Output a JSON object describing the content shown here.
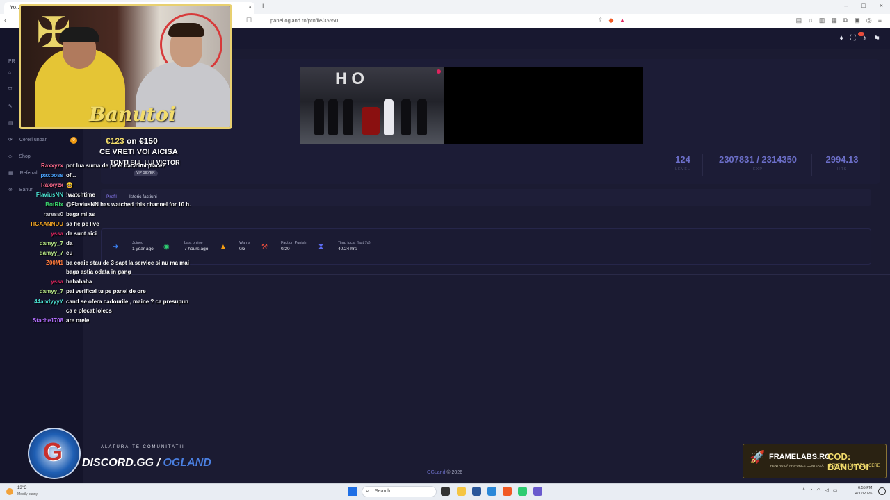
{
  "browser": {
    "tab_title": "Yo...",
    "tab_close": "×",
    "new_tab": "+",
    "url": "panel.ogland.ro/profile/35550",
    "win_min": "–",
    "win_max": "□",
    "win_close": "×"
  },
  "sidebar": {
    "section_label": "PR",
    "items": [
      {
        "label": "Cereri unban",
        "icon": "refresh-icon",
        "badge": "0"
      },
      {
        "label": "Shop",
        "icon": "diamond-icon"
      },
      {
        "label": "Referral",
        "icon": "gift-icon"
      },
      {
        "label": "Banuri",
        "icon": "ban-icon"
      }
    ]
  },
  "profile": {
    "stats": [
      {
        "value": "124",
        "label": "LEVEL"
      },
      {
        "value": "2307831 / 2314350",
        "label": "EXP"
      },
      {
        "value": "2994.13",
        "label": "HRS"
      }
    ],
    "tabs": [
      "Profil",
      "Istoric factiuni"
    ],
    "info": [
      {
        "label": "Joined",
        "value": "1 year ago",
        "icon": "login-icon",
        "color": "#3b82f6"
      },
      {
        "label": "Last online",
        "value": "7 hours ago",
        "icon": "gamepad-icon",
        "color": "#2ecc71"
      },
      {
        "label": "Warns",
        "value": "0/3",
        "icon": "warning-icon",
        "color": "#f39c12"
      },
      {
        "label": "Faction Punish",
        "value": "0/20",
        "icon": "gavel-icon",
        "color": "#e74c3c"
      },
      {
        "label": "Timp jucat (last 7d)",
        "value": "40.24 hrs",
        "icon": "hourglass-icon",
        "color": "#5b6bf0"
      }
    ]
  },
  "footer": {
    "brand": "OGLand",
    "text": "© 2026"
  },
  "stream": {
    "streamer_name": "Banutoi",
    "goal_current": "€123",
    "goal_mid": "on",
    "goal_target": "€150",
    "goal_message": "CE VRETI VOI AICISA",
    "goal_message2": "TONTI EUL LUI VICTOR",
    "vip_badge": "VIP SILVER",
    "chat": [
      {
        "user": "Raxxyzx",
        "color": "#ff6b8b",
        "msg": "pot lua suma de pe el dacă îmi place?"
      },
      {
        "user": "paxboss",
        "color": "#4aa3ff",
        "msg": "of..."
      },
      {
        "user": "Raxxyzx",
        "color": "#ff6b8b",
        "msg": "😄"
      },
      {
        "user": "FlaviusNN",
        "color": "#4adfd0",
        "msg": "!watchtime"
      },
      {
        "user": "BotRix",
        "color": "#3ad36a",
        "msg": "@FlaviusNN has watched this channel for 10 h."
      },
      {
        "user": "raress0",
        "color": "#c8c8d0",
        "msg": "baga mi as"
      },
      {
        "user": "TIGAANNUU",
        "color": "#f5a623",
        "msg": "sa fie pe live"
      },
      {
        "user": "yssa",
        "color": "#e0245e",
        "msg": "da sunt aici"
      },
      {
        "user": "damyy_7",
        "color": "#b8e986",
        "msg": "da"
      },
      {
        "user": "damyy_7",
        "color": "#b8e986",
        "msg": "eu"
      },
      {
        "user": "Z00M1",
        "color": "#ff7a3d",
        "msg": "ba coaie stau de 3 sapt la service si nu ma mai"
      },
      {
        "user": "",
        "color": "#ffffff",
        "msg": "baga astia odata in gang"
      },
      {
        "user": "yssa",
        "color": "#e0245e",
        "msg": "hahahaha"
      },
      {
        "user": "damyy_7",
        "color": "#b8e986",
        "msg": "pai verifical tu pe panel de ore"
      },
      {
        "user": "44andyyyY",
        "color": "#4adfd0",
        "msg": "cand se ofera cadourile , maine ? ca presupun"
      },
      {
        "user": "",
        "color": "#ffffff",
        "msg": "ca e plecat lolecs"
      },
      {
        "user": "Stache1708",
        "color": "#b46dff",
        "msg": "are orele"
      }
    ],
    "discord_join": "ALATURA-TE COMUNITATII",
    "discord_prefix": "DISCORD.GG /",
    "discord_name": "OGLAND",
    "promo_title": "FRAMELABS.RO",
    "promo_sub": "PENTRU CĂ FPS-URILE CONTEAZĂ",
    "promo_code": "COD: BANUTOI",
    "promo_discount": "PENTRU 10% REDUCERE"
  },
  "taskbar": {
    "temp": "13°C",
    "weather": "Mostly sunny",
    "search_placeholder": "Search",
    "time": "6:55 PM",
    "date": "4/12/2026"
  }
}
